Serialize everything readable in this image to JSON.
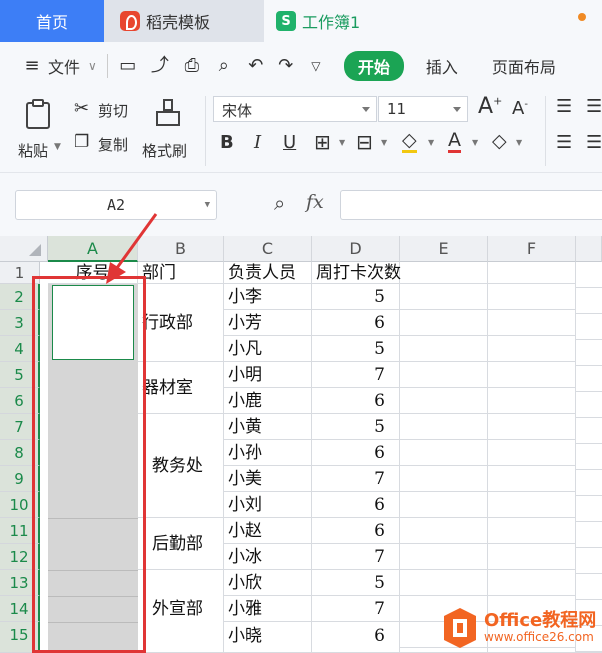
{
  "tabs": [
    {
      "label": "首页"
    },
    {
      "label": "稻壳模板"
    },
    {
      "label": "工作簿1",
      "icon_text": "S"
    }
  ],
  "menu": {
    "file": "文件",
    "start": "开始",
    "insert": "插入",
    "page_layout": "页面布局"
  },
  "ribbon": {
    "paste": "粘贴",
    "cut": "剪切",
    "copy": "复制",
    "format_painter": "格式刷",
    "font_name": "宋体",
    "font_size": "11",
    "bold": "B",
    "italic": "I",
    "underline": "U",
    "font_color": "A"
  },
  "formula": {
    "name_box": "A2",
    "fx": "fx"
  },
  "columns": [
    "A",
    "B",
    "C",
    "D",
    "E",
    "F"
  ],
  "rows": [
    "1",
    "2",
    "3",
    "4",
    "5",
    "6",
    "7",
    "8",
    "9",
    "10",
    "11",
    "12",
    "13",
    "14",
    "15"
  ],
  "header_row": {
    "a": "序号",
    "b": "部门",
    "c": "负责人员",
    "d": "周打卡次数"
  },
  "departments": [
    "行政部",
    "器材室",
    "教务处",
    "后勤部",
    "外宣部"
  ],
  "people": [
    "小李",
    "小芳",
    "小凡",
    "小明",
    "小鹿",
    "小黄",
    "小孙",
    "小美",
    "小刘",
    "小赵",
    "小冰",
    "小欣",
    "小雅",
    "小晓"
  ],
  "counts": [
    "5",
    "6",
    "5",
    "7",
    "6",
    "5",
    "6",
    "7",
    "6",
    "6",
    "7",
    "5",
    "7",
    "6"
  ],
  "watermark": {
    "title": "Office教程网",
    "url": "www.office26.com"
  },
  "colors": {
    "accent_green": "#1ba454",
    "tab_blue": "#3d7ef6",
    "annotation_red": "#e03535",
    "watermark_orange": "#f26522"
  }
}
